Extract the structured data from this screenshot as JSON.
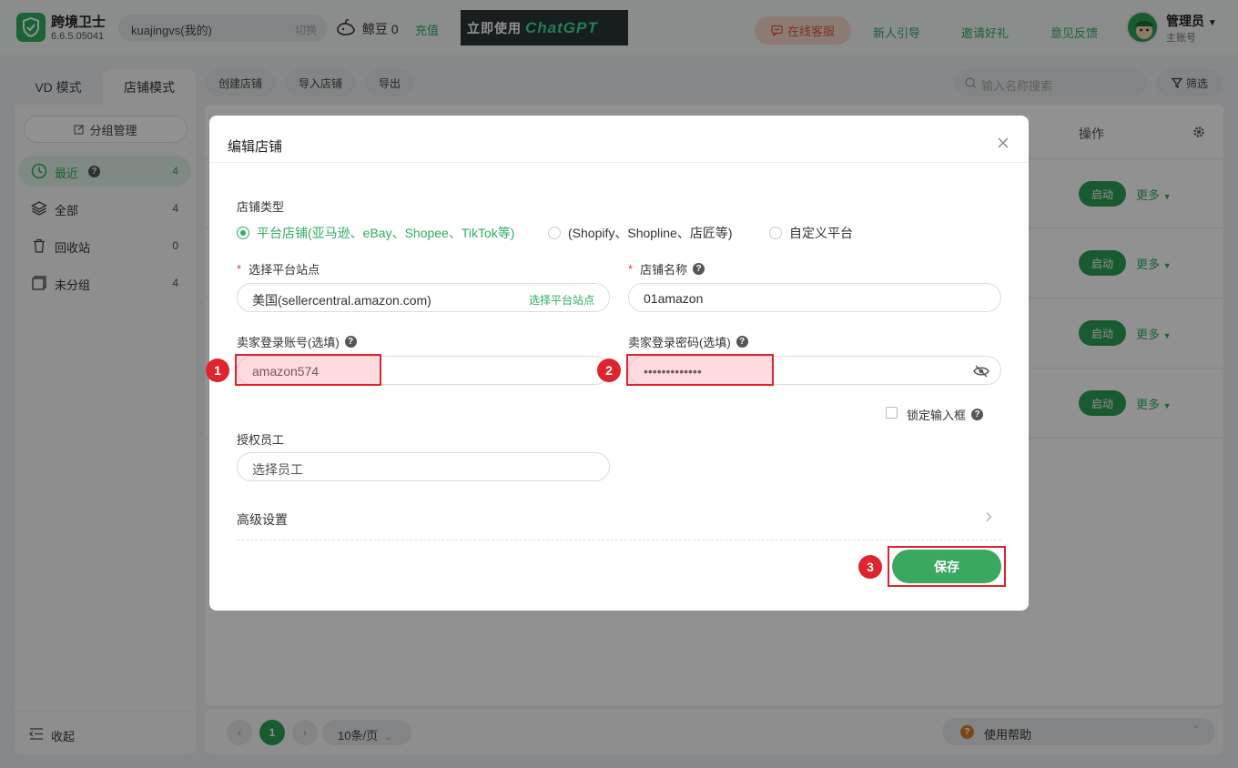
{
  "app": {
    "name": "跨境卫士",
    "version": "6.6.5.05041"
  },
  "account": {
    "name": "kuajingvs(我的)",
    "switch_label": "切换"
  },
  "beans": {
    "label": "鲸豆 0",
    "recharge": "充值"
  },
  "banner": {
    "text_a": "立即使用",
    "text_b": "ChatGPT"
  },
  "top_nav": {
    "service": "在线客服",
    "guide": "新人引导",
    "invite": "邀请好礼",
    "feedback": "意见反馈"
  },
  "user": {
    "name": "管理员",
    "role": "主账号"
  },
  "mode_tabs": {
    "vd": "VD 模式",
    "store": "店铺模式"
  },
  "sidebar": {
    "group_button": "分组管理",
    "items": [
      {
        "label": "最近",
        "count": "4"
      },
      {
        "label": "全部",
        "count": "4"
      },
      {
        "label": "回收站",
        "count": "0"
      },
      {
        "label": "未分组",
        "count": "4"
      }
    ],
    "collapse": "收起"
  },
  "toolbar": {
    "create": "创建店铺",
    "import": "导入店铺",
    "export": "导出",
    "search_placeholder": "输入名称搜索",
    "filter": "筛选"
  },
  "table": {
    "op_header": "操作",
    "rows": [
      {
        "start": "启动",
        "more": "更多"
      },
      {
        "start": "启动",
        "more": "更多"
      },
      {
        "start": "启动",
        "more": "更多"
      },
      {
        "start": "启动",
        "more": "更多"
      }
    ]
  },
  "pager": {
    "current": "1",
    "page_size": "10条/页",
    "help": "使用帮助"
  },
  "modal": {
    "title": "编辑店铺",
    "store_type_label": "店铺类型",
    "store_types": [
      "平台店铺(亚马逊、eBay、Shopee、TikTok等)",
      "(Shopify、Shopline、店匠等)",
      "自定义平台"
    ],
    "site_label": "选择平台站点",
    "site_value": "美国(sellercentral.amazon.com)",
    "site_action": "选择平台站点",
    "store_name_label": "店铺名称",
    "store_name_value": "01amazon",
    "seller_account_label": "卖家登录账号(选填)",
    "seller_account_value": "amazon574",
    "seller_password_label": "卖家登录密码(选填)",
    "seller_password_value": "•••••••••••••",
    "lock_label": "锁定输入框",
    "staff_label": "授权员工",
    "staff_placeholder": "选择员工",
    "advanced_label": "高级设置",
    "save_label": "保存"
  },
  "annotations": [
    "1",
    "2",
    "3"
  ],
  "colors": {
    "accent": "#2fae62",
    "highlight": "#e0242e",
    "service": "#e05b34"
  }
}
